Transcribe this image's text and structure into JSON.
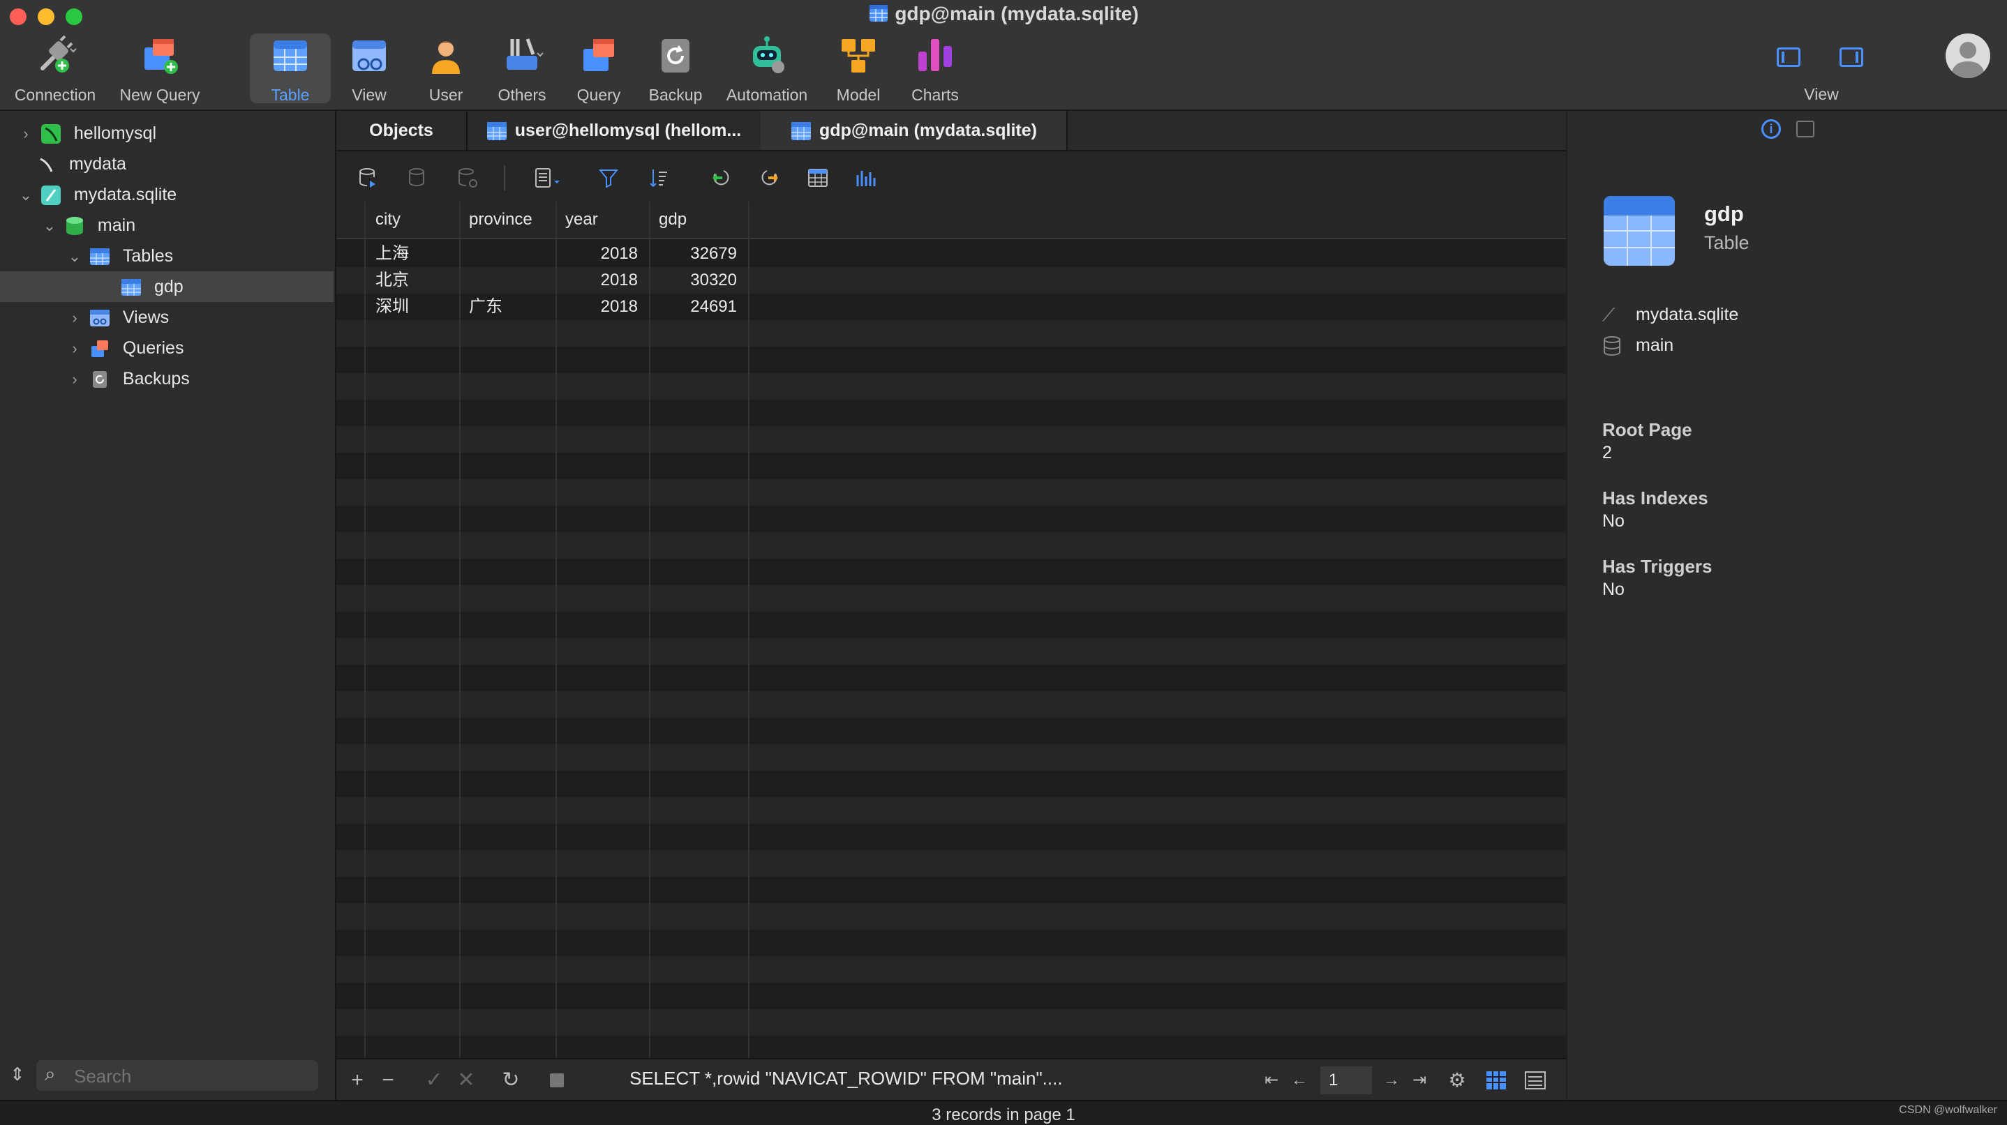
{
  "window": {
    "title": "gdp@main (mydata.sqlite)"
  },
  "toolbar": {
    "items": [
      {
        "label": "Connection",
        "icon": "connection-plug-icon"
      },
      {
        "label": "New Query",
        "icon": "new-query-icon"
      },
      {
        "label": "Table",
        "icon": "table-icon",
        "active": true
      },
      {
        "label": "View",
        "icon": "view-icon"
      },
      {
        "label": "User",
        "icon": "user-icon"
      },
      {
        "label": "Others",
        "icon": "others-tools-icon"
      },
      {
        "label": "Query",
        "icon": "query-icon"
      },
      {
        "label": "Backup",
        "icon": "backup-icon"
      },
      {
        "label": "Automation",
        "icon": "automation-robot-icon"
      },
      {
        "label": "Model",
        "icon": "model-icon"
      },
      {
        "label": "Charts",
        "icon": "charts-icon"
      }
    ],
    "view_label": "View"
  },
  "sidebar": {
    "tree": [
      {
        "label": "hellomysql",
        "icon": "mysql-connection-icon",
        "expanded": false
      },
      {
        "label": "mydata",
        "icon": "mysql-connection-icon"
      },
      {
        "label": "mydata.sqlite",
        "icon": "sqlite-connection-icon",
        "expanded": true
      },
      {
        "label": "main",
        "icon": "database-icon",
        "expanded": true
      },
      {
        "label": "Tables",
        "icon": "tables-folder-icon",
        "expanded": true
      },
      {
        "label": "gdp",
        "icon": "table-icon",
        "selected": true
      },
      {
        "label": "Views",
        "icon": "views-folder-icon",
        "expanded": false
      },
      {
        "label": "Queries",
        "icon": "queries-folder-icon",
        "expanded": false
      },
      {
        "label": "Backups",
        "icon": "backups-folder-icon",
        "expanded": false
      }
    ],
    "search_placeholder": "Search"
  },
  "tabs": [
    {
      "label": "Objects"
    },
    {
      "label": "user@hellomysql (hellom..."
    },
    {
      "label": "gdp@main (mydata.sqlite)",
      "active": true
    }
  ],
  "grid": {
    "columns": [
      "city",
      "province",
      "year",
      "gdp"
    ],
    "rows": [
      [
        "上海",
        "",
        "2018",
        "32679"
      ],
      [
        "北京",
        "",
        "2018",
        "30320"
      ],
      [
        "深圳",
        "广东",
        "2018",
        "24691"
      ]
    ]
  },
  "bottom": {
    "sql": "SELECT *,rowid \"NAVICAT_ROWID\" FROM \"main\"....",
    "page": "1",
    "status": "3 records in page 1"
  },
  "info": {
    "name": "gdp",
    "type": "Table",
    "file": "mydata.sqlite",
    "schema": "main",
    "fields": [
      {
        "label": "Root Page",
        "value": "2"
      },
      {
        "label": "Has Indexes",
        "value": "No"
      },
      {
        "label": "Has Triggers",
        "value": "No"
      }
    ]
  },
  "watermark": "CSDN @wolfwalker",
  "colors": {
    "accent": "#4a90ff",
    "table_blue": "#3b7fe6"
  }
}
